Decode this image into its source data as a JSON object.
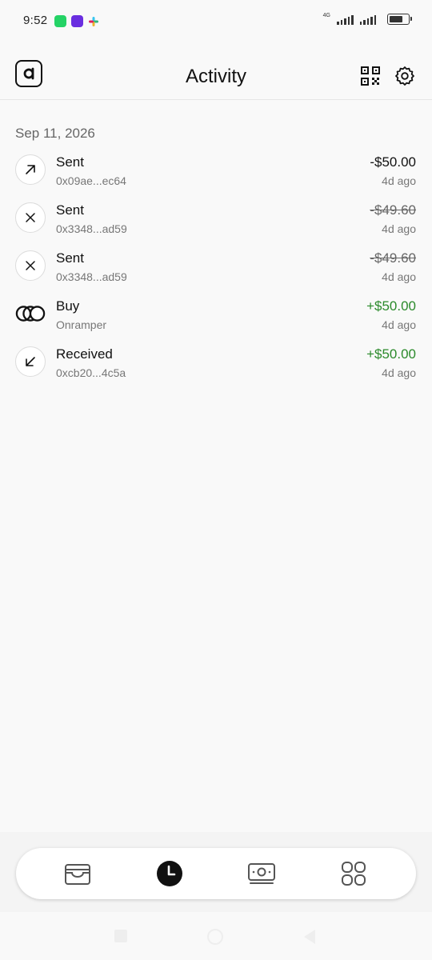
{
  "status_bar": {
    "time": "9:52",
    "network": "4G"
  },
  "header": {
    "title": "Activity"
  },
  "activity": {
    "date_heading": "Sep 11, 2026",
    "items": [
      {
        "icon": "arrow-up-right-icon",
        "title": "Sent",
        "subtitle": "0x09ae...ec64",
        "amount": "-$50.00",
        "time": "4d ago",
        "status": "completed"
      },
      {
        "icon": "x-icon",
        "title": "Sent",
        "subtitle": "0x3348...ad59",
        "amount": "-$49.60",
        "time": "4d ago",
        "status": "failed"
      },
      {
        "icon": "x-icon",
        "title": "Sent",
        "subtitle": "0x3348...ad59",
        "amount": "-$49.60",
        "time": "4d ago",
        "status": "failed"
      },
      {
        "icon": "onramper-icon",
        "title": "Buy",
        "subtitle": "Onramper",
        "amount": "+$50.00",
        "time": "4d ago",
        "status": "completed"
      },
      {
        "icon": "arrow-down-left-icon",
        "title": "Received",
        "subtitle": "0xcb20...4c5a",
        "amount": "+$50.00",
        "time": "4d ago",
        "status": "completed"
      }
    ]
  },
  "bottom_nav": {
    "items": [
      {
        "icon": "wallet-icon",
        "active": false
      },
      {
        "icon": "clock-icon",
        "active": true
      },
      {
        "icon": "cash-icon",
        "active": false
      },
      {
        "icon": "apps-grid-icon",
        "active": false
      }
    ]
  },
  "colors": {
    "positive": "#2b8a2b",
    "text": "#111111",
    "muted": "#777777",
    "background": "#f9f9f9"
  }
}
